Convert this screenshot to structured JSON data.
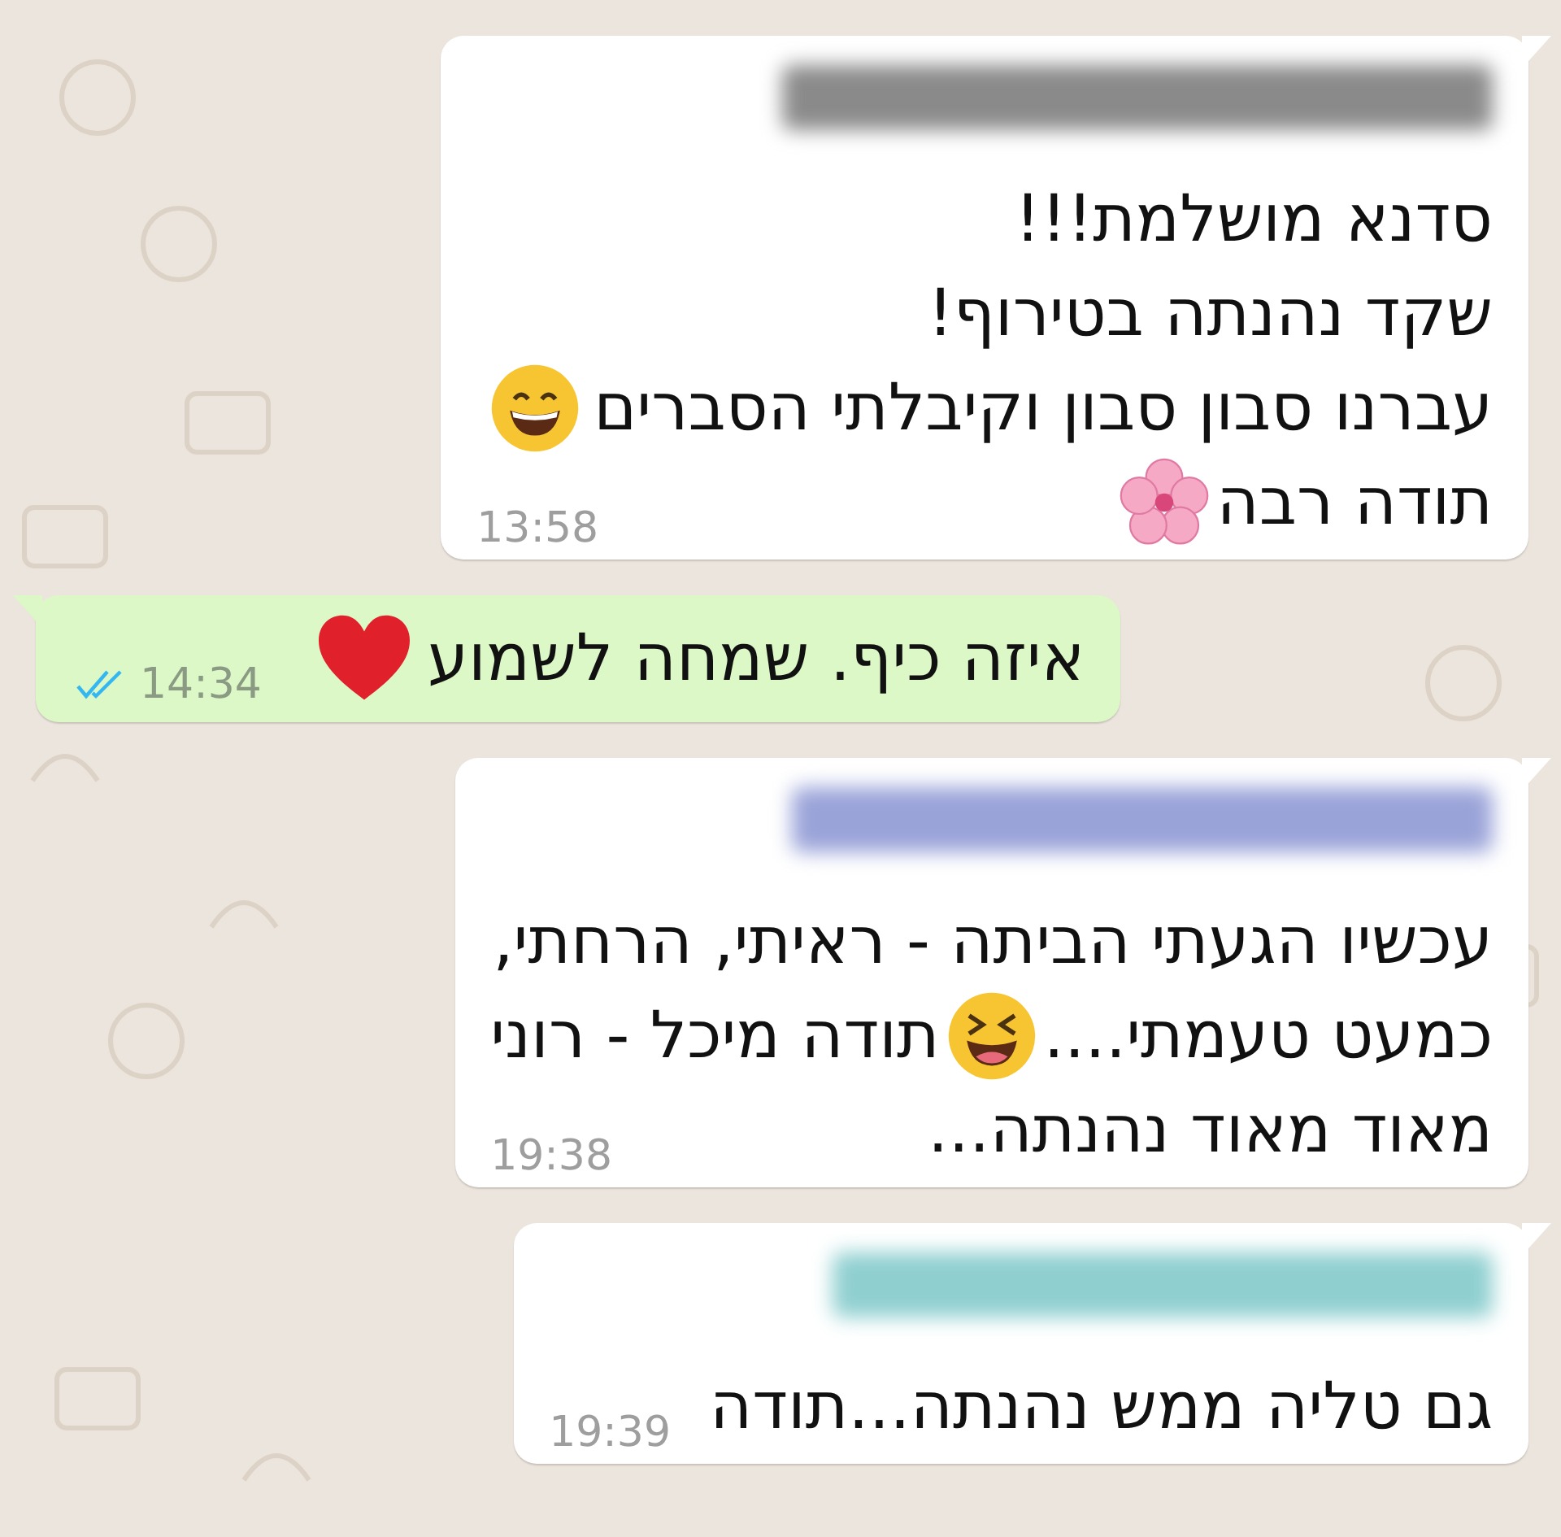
{
  "messages": [
    {
      "kind": "incoming",
      "color": "#8a8a8a",
      "lines": [
        [
          {
            "kind": "text",
            "text": "סדנא מושלמת!!!"
          }
        ],
        [
          {
            "kind": "text",
            "text": "שקד נהנתה בטירוף!"
          }
        ],
        [
          {
            "kind": "text",
            "text": "עברנו סבון סבון וקיבלתי הסברים"
          },
          {
            "kind": "grin"
          }
        ],
        [
          {
            "kind": "text",
            "text": "תודה רבה"
          },
          {
            "kind": "blossom"
          }
        ]
      ],
      "time": "13:58"
    },
    {
      "kind": "outgoing",
      "lines": [
        [
          {
            "kind": "text",
            "text": "איזה כיף. שמחה לשמוע"
          },
          {
            "kind": "heart"
          }
        ]
      ],
      "time": "14:34",
      "read": true
    },
    {
      "kind": "incoming",
      "color": "#9aa3d8",
      "lines": [
        [
          {
            "kind": "text",
            "text": "עכשיו הגעתי הביתה - ראיתי, הרחתי,"
          }
        ],
        [
          {
            "kind": "text",
            "text": "כמעט טעמתי...."
          },
          {
            "kind": "laugh"
          },
          {
            "kind": "text",
            "text": "תודה מיכל - רוני"
          }
        ],
        [
          {
            "kind": "text",
            "text": "מאוד מאוד נהנתה..."
          }
        ]
      ],
      "time": "19:38"
    },
    {
      "kind": "incoming",
      "color": "#8fcfd0",
      "lines": [
        [
          {
            "kind": "text",
            "text": "גם טליה ממש נהנתה...תודה"
          }
        ]
      ],
      "time": "19:39"
    }
  ]
}
